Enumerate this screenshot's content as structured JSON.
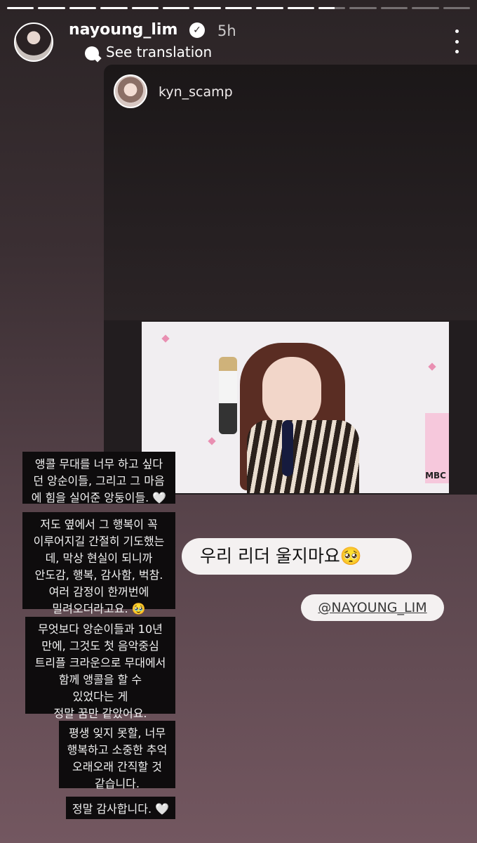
{
  "progress": {
    "segments": [
      1,
      1,
      1,
      1,
      1,
      1,
      1,
      1,
      1,
      1,
      0.6,
      0,
      0,
      0,
      0
    ]
  },
  "header": {
    "username": "nayoung_lim",
    "verified_badge": "✓",
    "time": "5h",
    "translate_label": "See translation",
    "icons": [
      "verified-icon",
      "translate-icon",
      "more-icon"
    ]
  },
  "shared_post": {
    "username": "kyn_scamp",
    "video_watermark": "MBC"
  },
  "stickers": {
    "text": "우리 리더 울지마요🥺",
    "mention": "@NAYOUNG_LIM"
  },
  "captions": [
    "앵콜 무대를 너무 하고 싶다\n던 앙순이들, 그리고 그 마음\n에 힘을 실어준 앙둥이들. 🤍",
    "저도 옆에서 그 행복이 꼭\n이루어지길 간절히 기도했는\n데, 막상 현실이 되니까\n안도감, 행복, 감사함, 벅참.\n여러 감정이 한꺼번에\n밀려오더라고요. 🥹",
    "무엇보다 앙순이들과 10년\n만에, 그것도 첫 음악중심\n트리플 크라운으로 무대에서\n함께 앵콜을 할 수\n있었다는 게\n정말 꿈만 같았어요.",
    "평생 잊지 못할, 너무\n행복하고 소중한 추억\n오래오래 간직할 것\n같습니다.",
    "정말 감사합니다. 🤍"
  ],
  "colors": {
    "background_top": "#2b2426",
    "background_bottom": "#735760",
    "caption_bg": "#0e0c0d",
    "sticker_bg": "#f4f1f1"
  }
}
